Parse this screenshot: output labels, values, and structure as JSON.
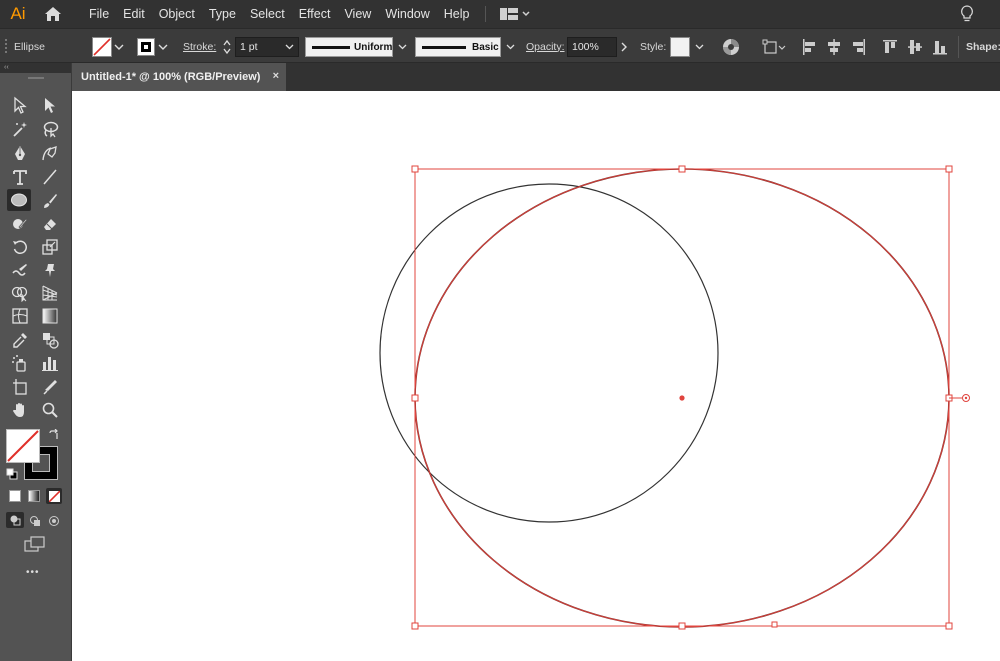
{
  "app": {
    "logo": "Ai"
  },
  "menu": [
    "File",
    "Edit",
    "Object",
    "Type",
    "Select",
    "Effect",
    "View",
    "Window",
    "Help"
  ],
  "control": {
    "tool_name": "Ellipse",
    "stroke_label": "Stroke:",
    "stroke_weight": "1 pt",
    "profile": "Uniform",
    "brush": "Basic",
    "opacity_label": "Opacity:",
    "opacity_value": "100%",
    "style_label": "Style:",
    "shape_label": "Shape:"
  },
  "document": {
    "tab_title": "Untitled-1* @ 100% (RGB/Preview)",
    "close": "×"
  },
  "colors": {
    "selection": "#e0443e",
    "accent_logo": "#ff9a00",
    "chrome_dark": "#323232",
    "panel": "#535353"
  },
  "icons": [
    "home-icon",
    "workspace-switcher-icon",
    "lightbulb-icon",
    "selection-tool-icon",
    "direct-selection-tool-icon",
    "magic-wand-icon",
    "lasso-icon",
    "pen-tool-icon",
    "curvature-tool-icon",
    "type-tool-icon",
    "line-tool-icon",
    "ellipse-tool-icon",
    "paintbrush-icon",
    "shaper-tool-icon",
    "eraser-icon",
    "rotate-icon",
    "scale-icon",
    "warp-icon",
    "puppet-warp-icon",
    "shape-builder-icon",
    "perspective-grid-icon",
    "mesh-icon",
    "gradient-icon",
    "eyedropper-icon",
    "blend-icon",
    "symbol-sprayer-icon",
    "column-graph-icon",
    "artboard-icon",
    "slice-icon",
    "hand-icon",
    "zoom-icon"
  ],
  "more_tools": "•••"
}
